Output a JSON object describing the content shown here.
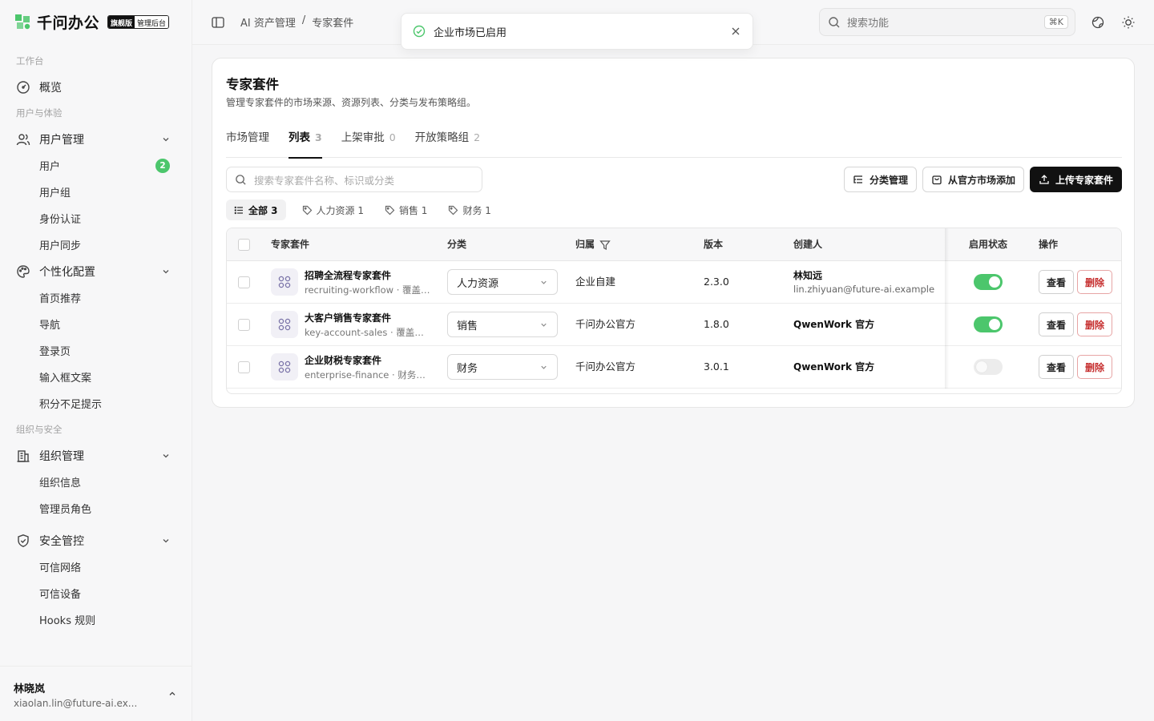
{
  "brand": {
    "name": "千问办公",
    "edition": "旗舰版",
    "mode": "管理后台",
    "color": "#4cc66c"
  },
  "sidebar": {
    "sections": [
      "工作台",
      "用户与体验",
      "组织与安全"
    ],
    "overview": "概览",
    "user_mgmt": {
      "label": "用户管理",
      "items": [
        {
          "label": "用户",
          "badge": "2"
        },
        {
          "label": "用户组"
        },
        {
          "label": "身份认证"
        },
        {
          "label": "用户同步"
        }
      ]
    },
    "personalization": {
      "label": "个性化配置",
      "items": [
        "首页推荐",
        "导航",
        "登录页",
        "输入框文案",
        "积分不足提示"
      ]
    },
    "org_mgmt": {
      "label": "组织管理",
      "items": [
        "组织信息",
        "管理员角色"
      ]
    },
    "security": {
      "label": "安全管控",
      "items": [
        "可信网络",
        "可信设备",
        "Hooks 规则"
      ]
    },
    "footer": {
      "name": "林晓岚",
      "email": "xiaolan.lin@future-ai.ex..."
    }
  },
  "topbar": {
    "breadcrumb": [
      "AI 资产管理",
      "/",
      "专家套件"
    ],
    "search_placeholder": "搜索功能",
    "shortcut": "⌘K"
  },
  "toast": {
    "message": "企业市场已启用"
  },
  "page": {
    "title": "专家套件",
    "description": "管理专家套件的市场来源、资源列表、分类与发布策略组。",
    "tabs": [
      {
        "label": "市场管理",
        "count": ""
      },
      {
        "label": "列表",
        "count": "3"
      },
      {
        "label": "上架审批",
        "count": "0"
      },
      {
        "label": "开放策略组",
        "count": "2"
      }
    ],
    "search_placeholder": "搜索专家套件名称、标识或分类",
    "buttons": {
      "category": "分类管理",
      "add_official": "从官方市场添加",
      "upload": "上传专家套件"
    },
    "filters": [
      {
        "label": "全部 3"
      },
      {
        "label": "人力资源 1"
      },
      {
        "label": "销售 1"
      },
      {
        "label": "财务 1"
      }
    ]
  },
  "table": {
    "headers": {
      "name": "专家套件",
      "category": "分类",
      "owner": "归属",
      "version": "版本",
      "creator": "创建人",
      "status": "启用状态",
      "actions": "操作"
    },
    "rows": [
      {
        "name": "招聘全流程专家套件",
        "sub": "recruiting-workflow · 覆盖招聘全流程",
        "category": "人力资源",
        "owner": "企业自建",
        "version": "2.3.0",
        "creator": "林知远",
        "creator_email": "lin.zhiyuan@future-ai.example",
        "enabled": true,
        "view": "查看",
        "delete": "删除"
      },
      {
        "name": "大客户销售专家套件",
        "sub": "key-account-sales · 覆盖大客户销售",
        "category": "销售",
        "owner": "千问办公官方",
        "version": "1.8.0",
        "creator": "QwenWork 官方",
        "creator_email": "",
        "enabled": true,
        "view": "查看",
        "delete": "删除"
      },
      {
        "name": "企业财税专家套件",
        "sub": "enterprise-finance · 财务与税务",
        "category": "财务",
        "owner": "千问办公官方",
        "version": "3.0.1",
        "creator": "QwenWork 官方",
        "creator_email": "",
        "enabled": false,
        "view": "查看",
        "delete": "删除"
      }
    ]
  }
}
